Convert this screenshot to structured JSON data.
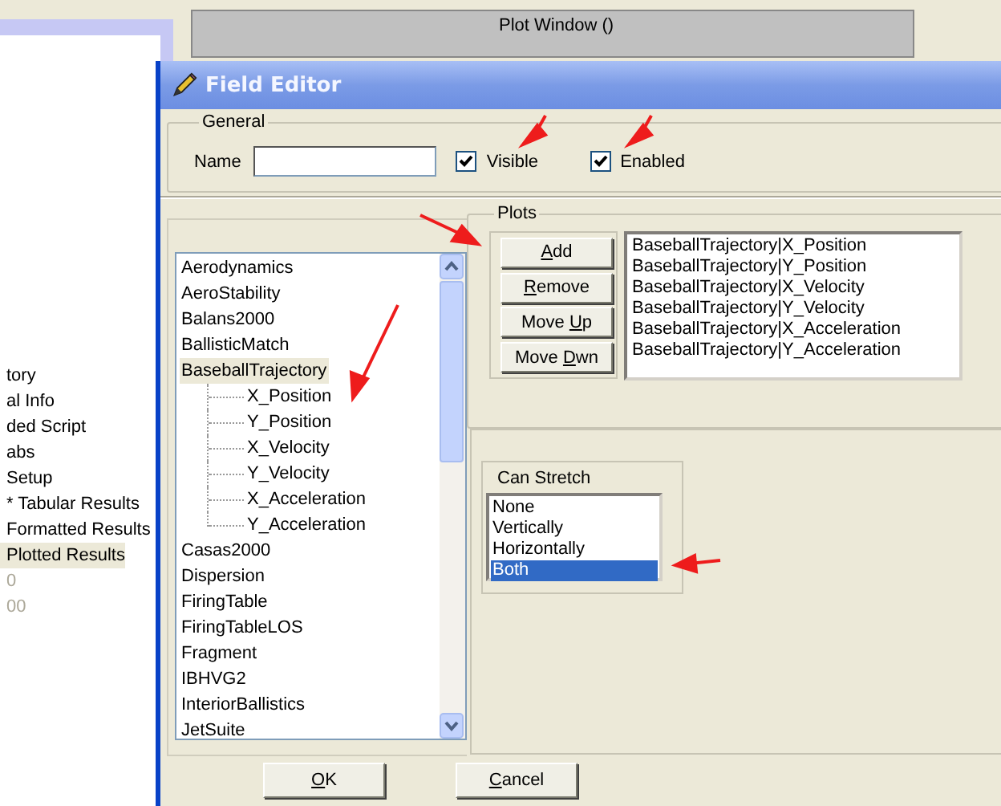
{
  "background": {
    "plot_window_title": "Plot Window ()",
    "tree_items": [
      {
        "label": "tory",
        "selected": false,
        "disabled": false
      },
      {
        "label": "al Info",
        "selected": false,
        "disabled": false
      },
      {
        "label": "ded Script",
        "selected": false,
        "disabled": false
      },
      {
        "label": "abs",
        "selected": false,
        "disabled": false
      },
      {
        "label": "Setup",
        "selected": false,
        "disabled": false
      },
      {
        "label": "* Tabular Results",
        "selected": false,
        "disabled": false
      },
      {
        "label": "Formatted Results",
        "selected": false,
        "disabled": false
      },
      {
        "label": "Plotted Results",
        "selected": true,
        "disabled": false
      },
      {
        "label": "0",
        "selected": false,
        "disabled": true
      },
      {
        "label": "00",
        "selected": false,
        "disabled": true
      }
    ]
  },
  "dialog": {
    "title": "Field Editor",
    "general": {
      "label": "General",
      "name_label": "Name",
      "visible": {
        "label": "Visible",
        "checked": true
      },
      "enabled": {
        "label": "Enabled",
        "checked": true
      }
    },
    "fields_tree": [
      {
        "label": "Aerodynamics",
        "selected": false
      },
      {
        "label": "AeroStability",
        "selected": false
      },
      {
        "label": "Balans2000",
        "selected": false
      },
      {
        "label": "BallisticMatch",
        "selected": false
      },
      {
        "label": "BaseballTrajectory",
        "selected": true,
        "children": [
          {
            "label": "X_Position",
            "selected": false
          },
          {
            "label": "Y_Position",
            "selected": false
          },
          {
            "label": "X_Velocity",
            "selected": false
          },
          {
            "label": "Y_Velocity",
            "selected": false
          },
          {
            "label": "X_Acceleration",
            "selected": false
          },
          {
            "label": "Y_Acceleration",
            "selected": false
          }
        ]
      },
      {
        "label": "Casas2000",
        "selected": false
      },
      {
        "label": "Dispersion",
        "selected": false
      },
      {
        "label": "FiringTable",
        "selected": false
      },
      {
        "label": "FiringTableLOS",
        "selected": false
      },
      {
        "label": "Fragment",
        "selected": false
      },
      {
        "label": "IBHVG2",
        "selected": false
      },
      {
        "label": "InteriorBallistics",
        "selected": false
      },
      {
        "label": "JetSuite",
        "selected": false
      }
    ],
    "plots": {
      "label": "Plots",
      "buttons": [
        {
          "access_key": "A",
          "label_rest": "dd"
        },
        {
          "access_key": "R",
          "label_rest": "emove"
        },
        {
          "label_start": "Move ",
          "access_key": "U",
          "label_rest": "p"
        },
        {
          "label_start": "Move ",
          "access_key": "D",
          "label_rest": "wn"
        }
      ],
      "items": [
        "BaseballTrajectory|X_Position",
        "BaseballTrajectory|Y_Position",
        "BaseballTrajectory|X_Velocity",
        "BaseballTrajectory|Y_Velocity",
        "BaseballTrajectory|X_Acceleration",
        "BaseballTrajectory|Y_Acceleration"
      ]
    },
    "can_stretch": {
      "label": "Can Stretch",
      "options": [
        {
          "label": "None",
          "selected": false
        },
        {
          "label": "Vertically",
          "selected": false
        },
        {
          "label": "Horizontally",
          "selected": false
        },
        {
          "label": "Both",
          "selected": true
        }
      ]
    },
    "buttons": [
      {
        "access_key": "O",
        "label_rest": "K"
      },
      {
        "access_key": "C",
        "label_rest": "ancel"
      }
    ]
  }
}
